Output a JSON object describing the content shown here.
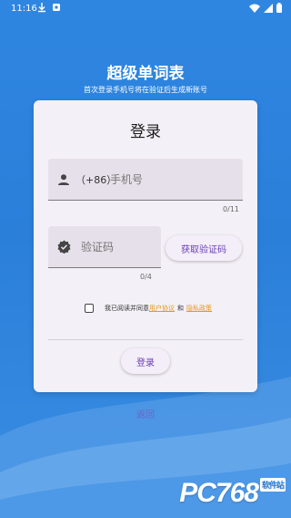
{
  "status_bar": {
    "time": "11:16"
  },
  "app": {
    "title": "超级单词表",
    "subtitle": "首次登录手机号将在验证后生成新账号"
  },
  "card": {
    "title": "登录",
    "phone": {
      "prefix": "（+86）",
      "placeholder": "手机号",
      "value": "",
      "counter": "0/11"
    },
    "code": {
      "placeholder": "验证码",
      "value": "",
      "counter": "0/4",
      "get_code_label": "获取验证码"
    },
    "agreement": {
      "prefix": "我已阅读并同意",
      "user_agreement": "用户协议",
      "and": "和",
      "privacy_policy": "隐私政策",
      "checked": false
    },
    "login_label": "登录"
  },
  "back_label": "返回",
  "watermark": {
    "text": "PC768",
    "tag": "软件站"
  },
  "colors": {
    "background": "#2a7fd9",
    "accent": "#6a3fb5",
    "link": "#e39a1c"
  },
  "icons": {
    "phone_icon": "person-icon",
    "code_icon": "verified-badge-icon"
  }
}
